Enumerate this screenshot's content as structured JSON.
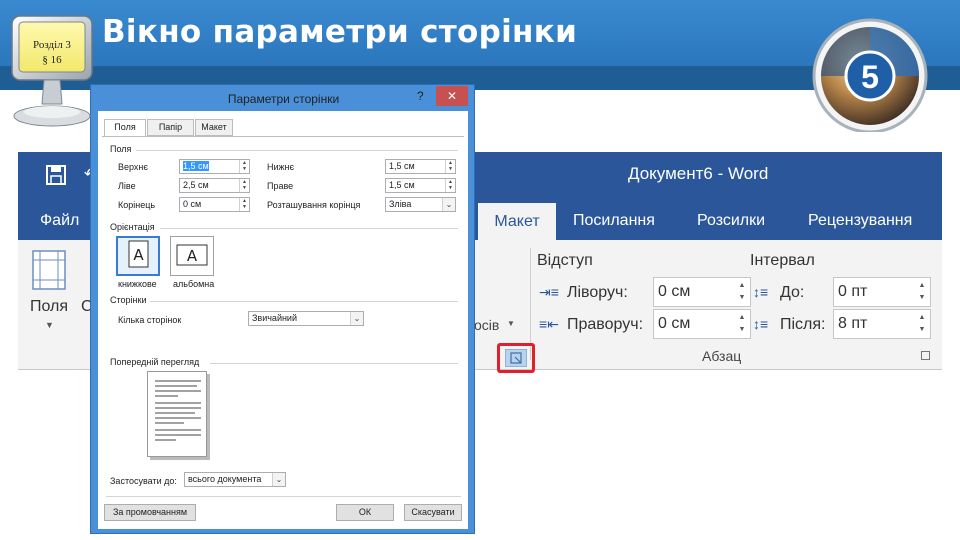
{
  "slide": {
    "title": "Вікно параметри сторінки",
    "section_label": "Розділ 3",
    "paragraph_label": "§ 16",
    "grade_badge": "5"
  },
  "word": {
    "document_title": "Документ6  -  Word",
    "tabs": [
      "Файл",
      "Макет",
      "Посилання",
      "Розсилки",
      "Рецензування"
    ],
    "active_tab": "Макет",
    "ribbon": {
      "fields_button": "Поля",
      "fields_button_more": "С",
      "columns_fragment": "осів",
      "indent_title": "Відступ",
      "spacing_title": "Інтервал",
      "left_indent_label": "Ліворуч:",
      "left_indent_value": "0 см",
      "right_indent_label": "Праворуч:",
      "right_indent_value": "0 см",
      "before_label": "До:",
      "before_value": "0 пт",
      "after_label": "Після:",
      "after_value": "8 пт",
      "group_label": "Абзац"
    }
  },
  "dialog": {
    "title": "Параметри сторінки",
    "help": "?",
    "close": "✕",
    "tabs": [
      "Поля",
      "Папір",
      "Макет"
    ],
    "margins_section": "Поля",
    "top_label": "Верхнє",
    "top_value": "1,5 см",
    "bottom_label": "Нижнє",
    "bottom_value": "1,5 см",
    "left_label": "Ліве",
    "left_value": "2,5 см",
    "right_label": "Праве",
    "right_value": "1,5 см",
    "gutter_label": "Корінець",
    "gutter_value": "0 см",
    "gutter_pos_label": "Розташування корінця",
    "gutter_pos_value": "Зліва",
    "orientation_section": "Орієнтація",
    "portrait_label": "книжкове",
    "landscape_label": "альбомна",
    "pages_section": "Сторінки",
    "multiple_pages_label": "Кілька сторінок",
    "multiple_pages_value": "Звичайний",
    "preview_section": "Попередній перегляд",
    "apply_to_label": "Застосувати до:",
    "apply_to_value": "всього документа",
    "default_button": "За промовчанням",
    "ok_button": "ОК",
    "cancel_button": "Скасувати",
    "orientation_glyph": "A"
  },
  "colors": {
    "header": "#2b76bd",
    "word_blue": "#2b579a",
    "highlight": "#e0202a"
  }
}
